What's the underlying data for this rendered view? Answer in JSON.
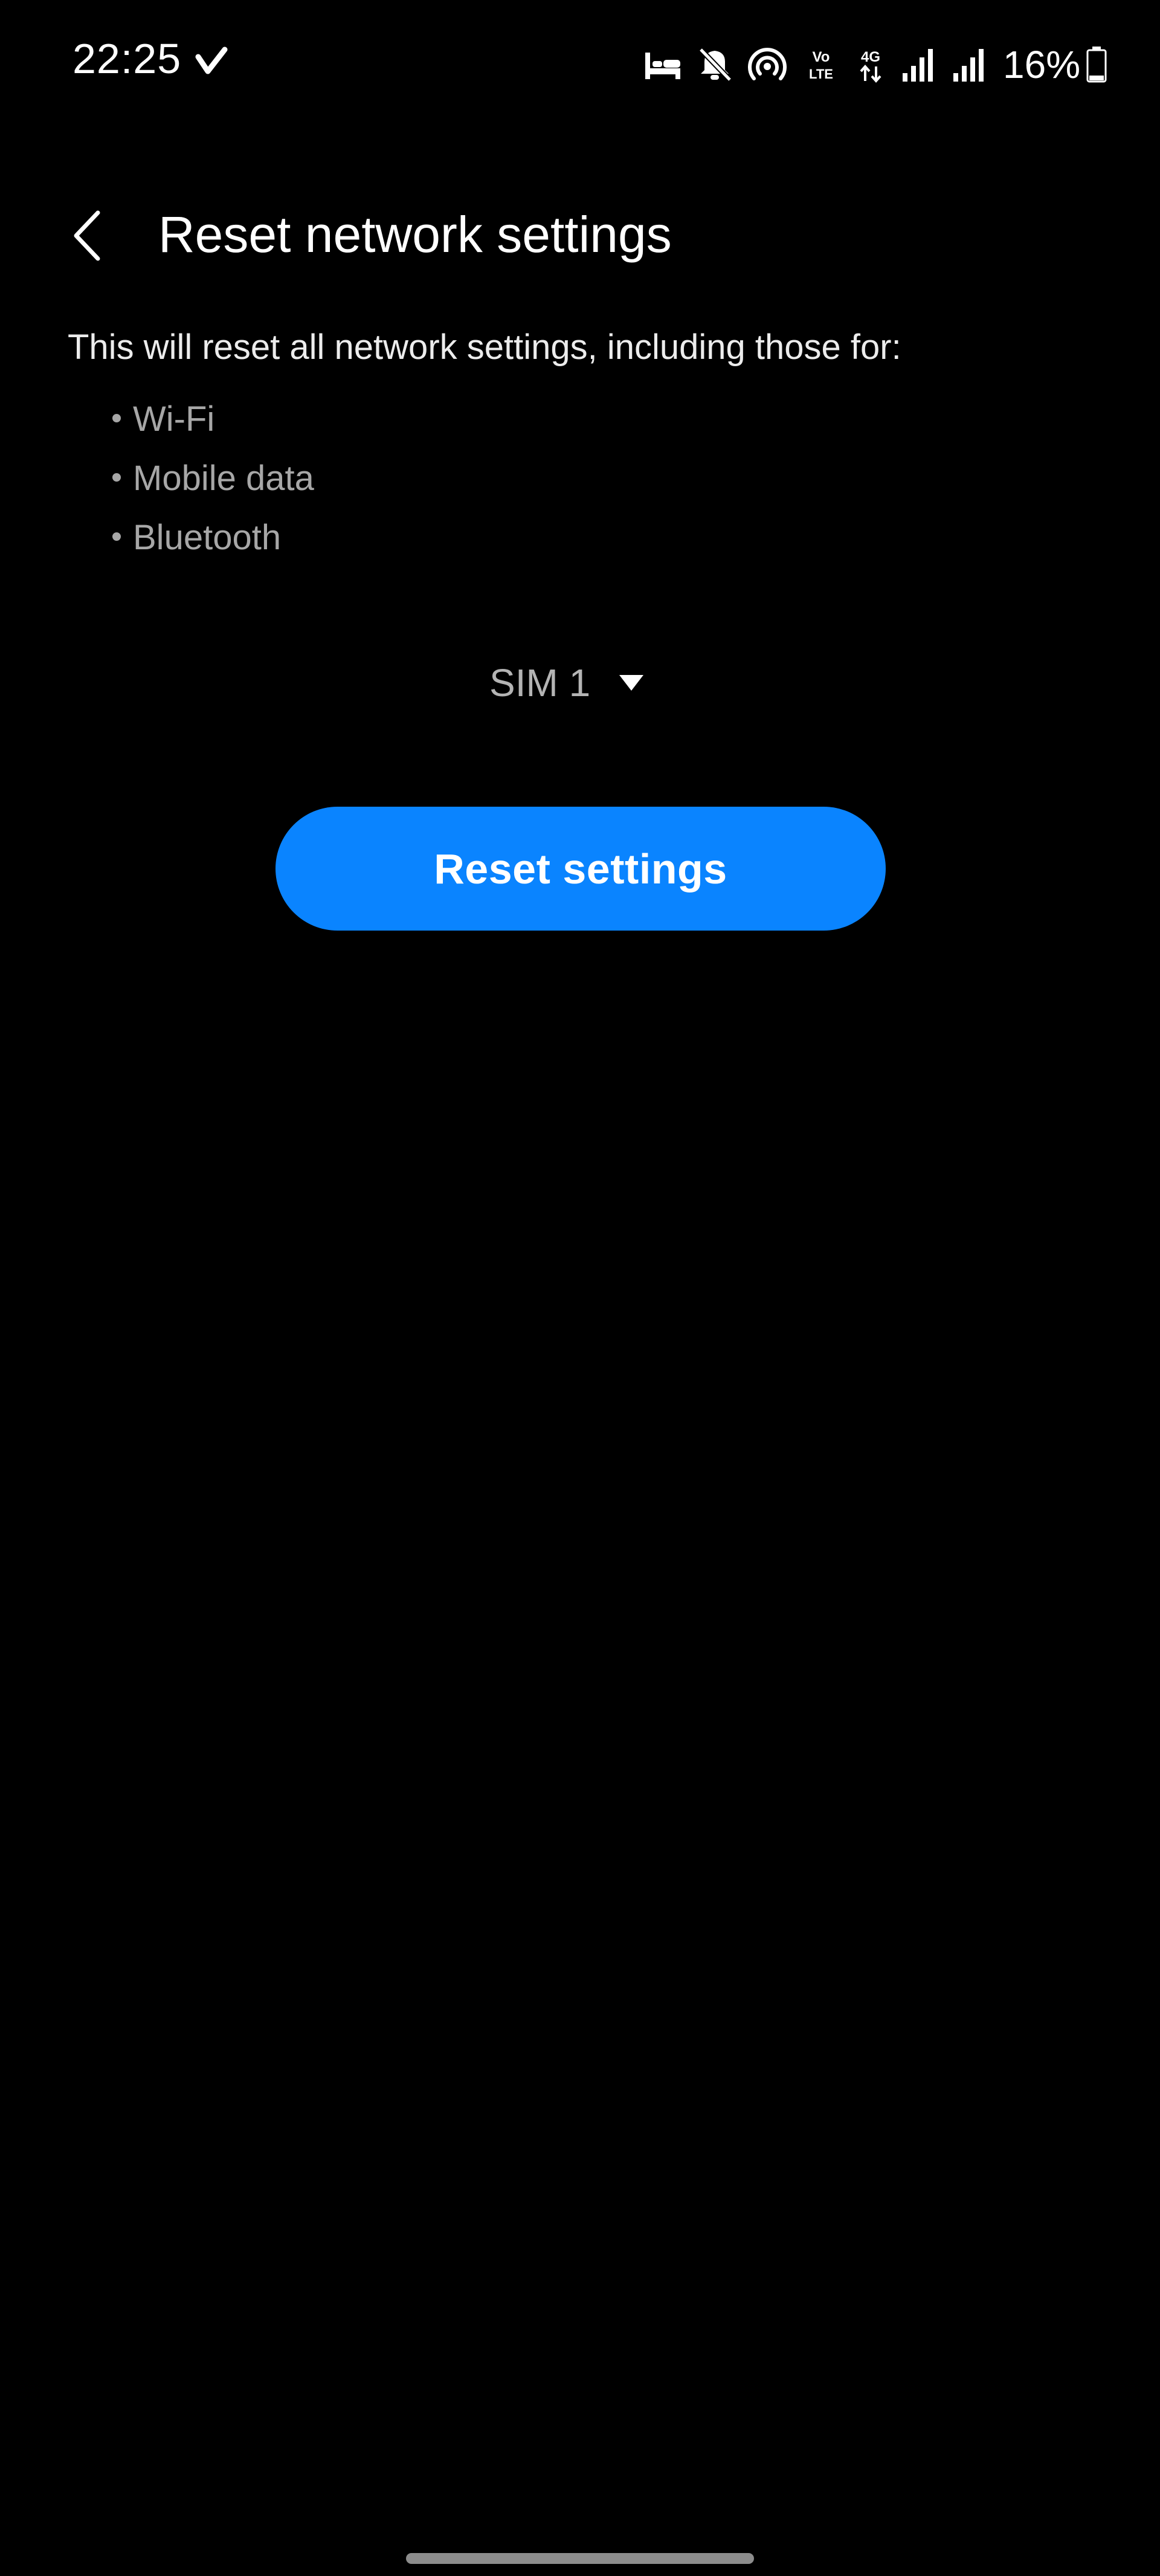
{
  "status_bar": {
    "time": "22:25",
    "battery_percent": "16%",
    "icons": [
      "check-icon",
      "sleep-mode-icon",
      "mute-icon",
      "hotspot-icon",
      "volte-icon",
      "4g-data-icon",
      "signal-sim1-icon",
      "signal-sim2-icon",
      "battery-icon"
    ],
    "volte_label": "VoLTE",
    "data_label": "4G"
  },
  "header": {
    "title": "Reset network settings",
    "back_icon": "chevron-left-icon"
  },
  "description": {
    "text": "This will reset all network settings, including those for:",
    "items": [
      "Wi-Fi",
      "Mobile data",
      "Bluetooth"
    ]
  },
  "sim_select": {
    "selected": "SIM 1",
    "arrow_icon": "caret-down-icon"
  },
  "actions": {
    "reset_label": "Reset settings"
  },
  "colors": {
    "background": "#000000",
    "accent": "#0a84ff",
    "primary_text": "#ffffff",
    "secondary_text": "#a7a7a7"
  }
}
